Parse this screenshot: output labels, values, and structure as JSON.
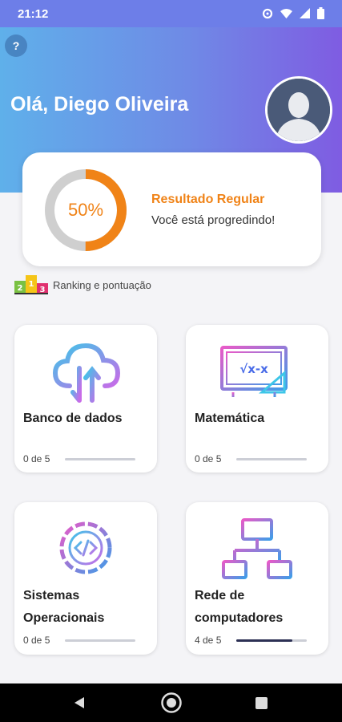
{
  "status": {
    "time": "21:12"
  },
  "header": {
    "help_label": "?",
    "greeting": "Olá, Diego Oliveira"
  },
  "result": {
    "percent_text": "50%",
    "percent": 50,
    "title": "Resultado Regular",
    "subtitle": "Você está progredindo!"
  },
  "ranking": {
    "label": "Ranking e pontuação",
    "podium": [
      "2",
      "1",
      "3"
    ]
  },
  "categories": [
    {
      "title_lines": [
        "Banco de dados"
      ],
      "progress_text": "0 de 5",
      "progress": 0,
      "icon": "cloud-sync-icon"
    },
    {
      "title_lines": [
        "Matemática"
      ],
      "progress_text": "0 de 5",
      "progress": 0,
      "icon": "math-board-icon",
      "board_text": "√x-x"
    },
    {
      "title_lines": [
        "Sistemas",
        "Operacionais"
      ],
      "progress_text": "0 de 5",
      "progress": 0,
      "icon": "code-gear-icon"
    },
    {
      "title_lines": [
        "Rede de",
        "computadores"
      ],
      "progress_text": "4 de 5",
      "progress": 0.8,
      "icon": "network-icon"
    }
  ],
  "colors": {
    "accent": "#f08317",
    "ring_track": "#cfcfcf",
    "progress_fill": "#2c3054"
  }
}
